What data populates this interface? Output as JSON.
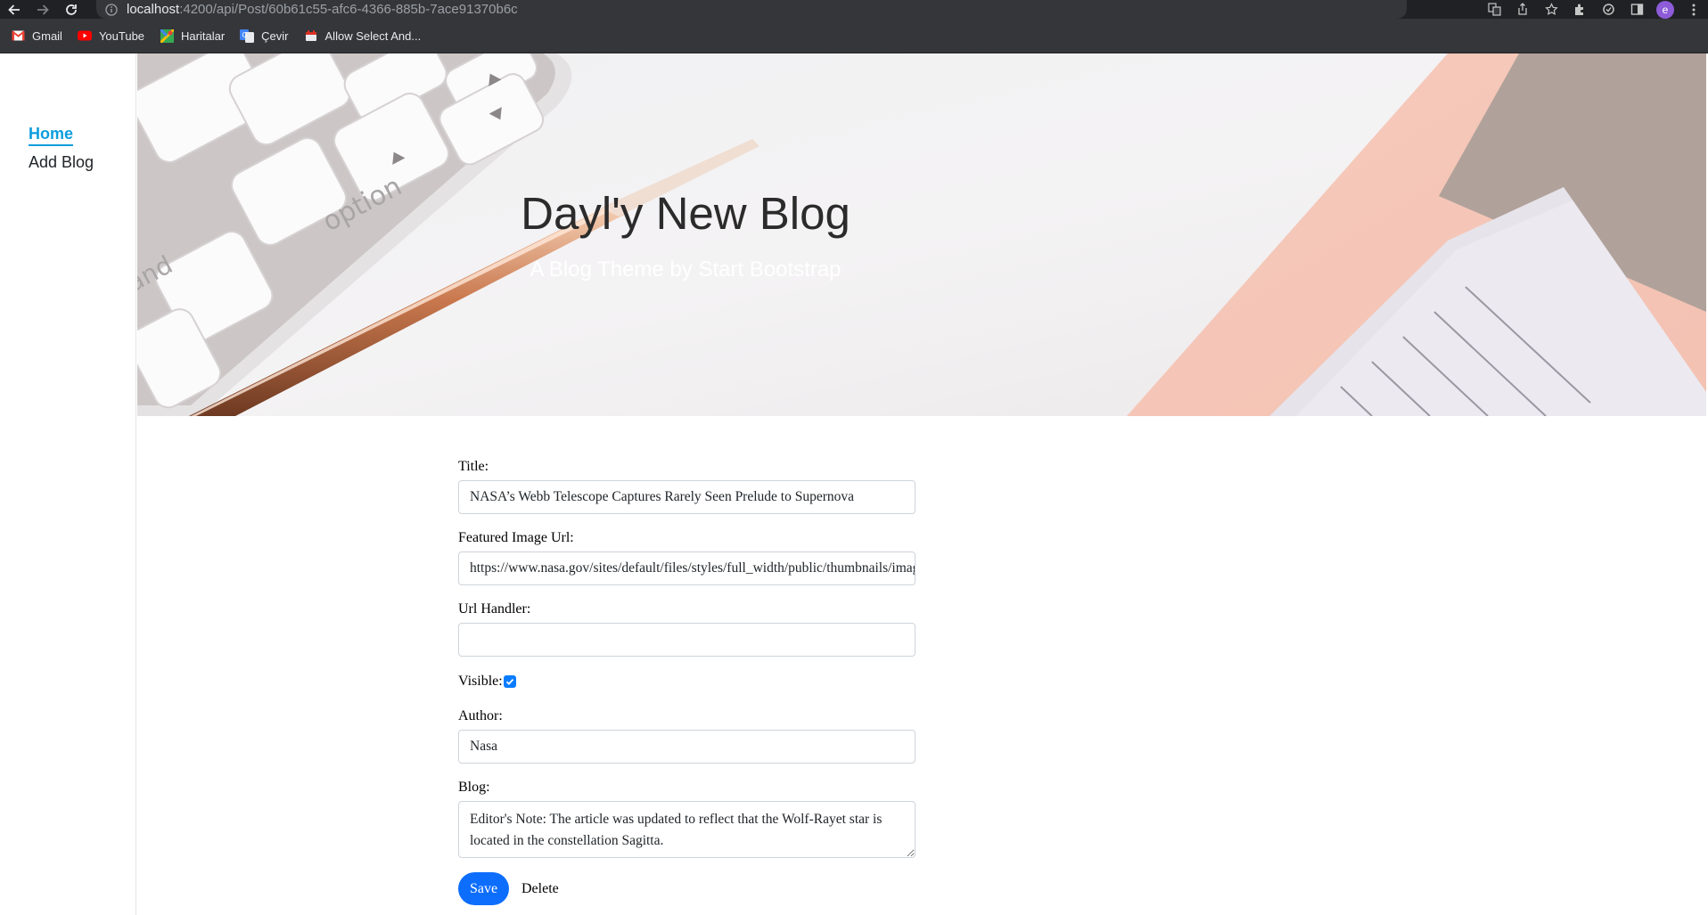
{
  "browser": {
    "url_host": "localhost",
    "url_rest": ":4200/api/Post/60b61c55-afc6-4366-885b-7ace91370b6c",
    "profile_initial": "e",
    "bookmarks": [
      {
        "label": "Gmail",
        "icon": "gmail-icon",
        "color": "#ea4335"
      },
      {
        "label": "YouTube",
        "icon": "youtube-icon",
        "color": "#ff0000"
      },
      {
        "label": "Haritalar",
        "icon": "maps-icon",
        "color": "#34a853"
      },
      {
        "label": "Çevir",
        "icon": "translate-icon",
        "color": "#4285f4"
      },
      {
        "label": "Allow Select And...",
        "icon": "extension-favicon-icon",
        "color": "#d93025"
      }
    ]
  },
  "sidebar": {
    "items": [
      {
        "label": "Home",
        "active": true
      },
      {
        "label": "Add Blog",
        "active": false
      }
    ]
  },
  "hero": {
    "title": "Dayl'y New Blog",
    "subtitle": "A Blog Theme by Start Bootstrap"
  },
  "form": {
    "title_label": "Title:",
    "title_value": "NASA’s Webb Telescope Captures Rarely Seen Prelude to Supernova",
    "image_label": "Featured Image Url:",
    "image_value": "https://www.nasa.gov/sites/default/files/styles/full_width/public/thumbnails/image/",
    "url_handler_label": "Url Handler:",
    "url_handler_value": "",
    "visible_label": "Visible:",
    "visible_checked": true,
    "author_label": "Author:",
    "author_value": "Nasa",
    "blog_label": "Blog:",
    "blog_value": "Editor's Note: The article was updated to reflect that the Wolf-Rayet star is located in the constellation Sagitta.",
    "save_label": "Save",
    "delete_label": "Delete"
  }
}
